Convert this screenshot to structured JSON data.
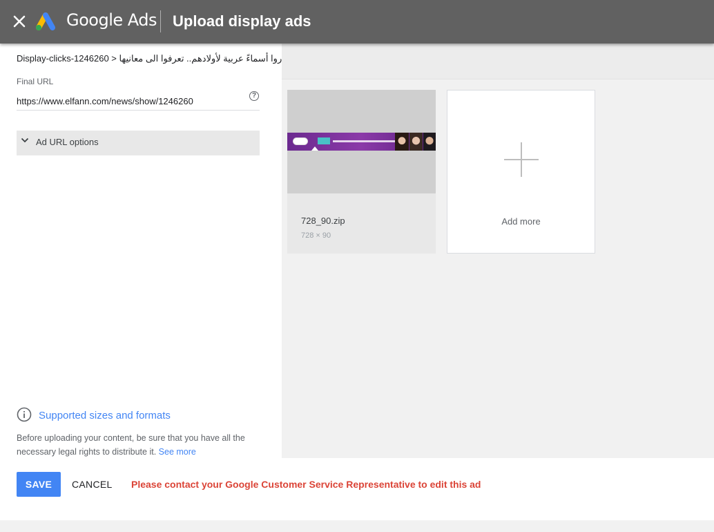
{
  "header": {
    "brand": "Google Ads",
    "title": "Upload display ads"
  },
  "breadcrumb": {
    "campaign": "Display-clicks-1246260",
    "separator": ">",
    "ad_group": "دلاروا أسماءً عربية لأولادهم.. تعرفوا الى معانيها"
  },
  "final_url": {
    "label": "Final URL",
    "value": "https://www.elfann.com/news/show/1246260"
  },
  "ad_url_options": {
    "label": "Ad URL options"
  },
  "info": {
    "link": "Supported sizes and formats",
    "legal_text": "Before uploading your content, be sure that you have all the necessary legal rights to distribute it.",
    "see_more": "See more"
  },
  "files": [
    {
      "name": "728_90.zip",
      "size": "728 × 90"
    }
  ],
  "add_more": {
    "label": "Add more"
  },
  "footer": {
    "save_label": "SAVE",
    "cancel_label": "CANCEL",
    "warning": "Please contact your Google Customer Service Representative to edit this ad"
  },
  "colors": {
    "header_bg": "#616161",
    "accent": "#4285f4",
    "warning": "#db4437"
  }
}
